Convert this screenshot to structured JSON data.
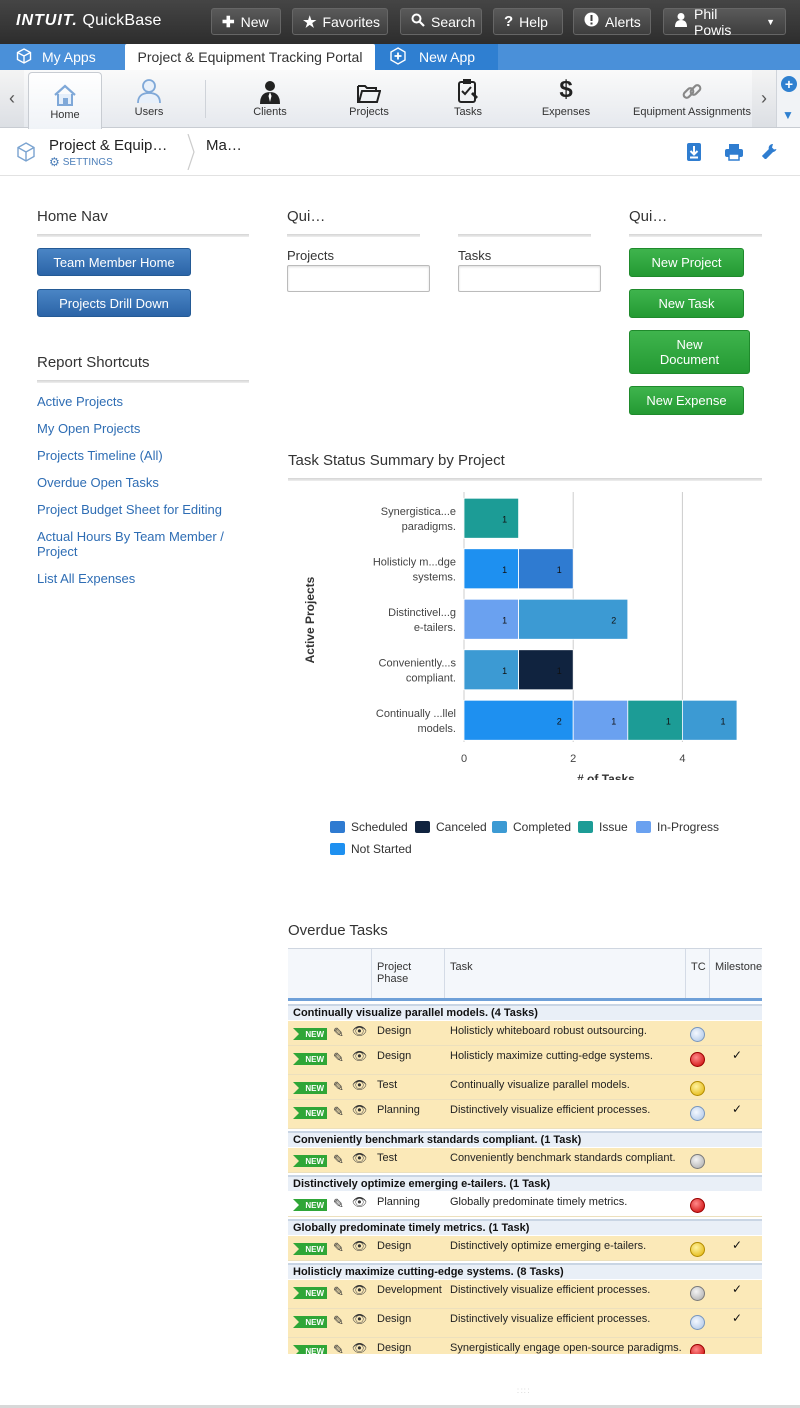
{
  "topbar": {
    "logo_brand": "INTUIT.",
    "logo_product": "QuickBase",
    "buttons": [
      {
        "label": "New",
        "icon": "plus-icon"
      },
      {
        "label": "Favorites",
        "icon": "star-icon"
      },
      {
        "label": "Search",
        "icon": "search-icon"
      },
      {
        "label": "Help",
        "icon": "help-icon"
      },
      {
        "label": "Alerts",
        "icon": "alert-icon"
      }
    ],
    "user": "Phil Powis"
  },
  "tabs": {
    "my_apps": "My Apps",
    "portal": "Project & Equipment Tracking Portal",
    "new_app": "New App"
  },
  "nav": {
    "items": [
      {
        "label": "Home",
        "icon": "home-icon"
      },
      {
        "label": "Users",
        "icon": "users-icon"
      },
      {
        "label": "Clients",
        "icon": "person-icon"
      },
      {
        "label": "Projects",
        "icon": "folder-icon"
      },
      {
        "label": "Tasks",
        "icon": "clipboard-icon"
      },
      {
        "label": "Expenses",
        "icon": "dollar-icon"
      },
      {
        "label": "Equipment Assignments",
        "icon": "link-icon"
      }
    ]
  },
  "breadcrumb": {
    "app_name": "Project & Equip…",
    "settings": "SETTINGS",
    "page": "Ma…"
  },
  "home_nav": {
    "title": "Home Nav",
    "buttons": [
      "Team Member Home",
      "Projects Drill Down"
    ]
  },
  "report_shortcuts": {
    "title": "Report Shortcuts",
    "links": [
      "Active Projects",
      "My Open Projects",
      "Projects Timeline (All)",
      "Overdue Open Tasks",
      "Project Budget Sheet for Editing",
      "Actual Hours By Team Member / Project",
      "List All Expenses"
    ]
  },
  "quick_search": {
    "title": "Qui…",
    "fields": [
      {
        "label": "Projects",
        "value": ""
      },
      {
        "label": "Tasks",
        "value": ""
      }
    ]
  },
  "quick_add": {
    "title": "Qui…",
    "buttons": [
      "New Project",
      "New Task",
      "New Document",
      "New Expense"
    ]
  },
  "chart_title": "Task Status Summary by Project",
  "chart_data": {
    "type": "bar",
    "orientation": "horizontal",
    "stacked": true,
    "categories": [
      "Synergistica...e paradigms.",
      "Holisticly m...dge systems.",
      "Distinctivel...g e-tailers.",
      "Conveniently...s compliant.",
      "Continually ...llel models."
    ],
    "series": [
      {
        "name": "Not Started",
        "color": "#1e90f0",
        "values": [
          0,
          1,
          0,
          0,
          2
        ]
      },
      {
        "name": "Scheduled",
        "color": "#2f7bd1",
        "values": [
          0,
          1,
          0,
          0,
          0
        ]
      },
      {
        "name": "In-Progress",
        "color": "#6aa1f0",
        "values": [
          0,
          0,
          1,
          0,
          1
        ]
      },
      {
        "name": "Issue",
        "color": "#1c9c96",
        "values": [
          1,
          0,
          0,
          0,
          1
        ]
      },
      {
        "name": "Completed",
        "color": "#3c9ad3",
        "values": [
          0,
          0,
          2,
          1,
          1
        ]
      },
      {
        "name": "Canceled",
        "color": "#10233f",
        "values": [
          0,
          0,
          0,
          1,
          0
        ]
      }
    ],
    "xlabel": "# of Tasks",
    "ylabel": "Active Projects",
    "xlim": [
      0,
      5
    ],
    "xticks": [
      0,
      2,
      4
    ],
    "legend": {
      "position": "bottom",
      "order": [
        "Scheduled",
        "Canceled",
        "Completed",
        "Issue",
        "In-Progress",
        "Not Started"
      ]
    },
    "grid": true
  },
  "overdue": {
    "title": "Overdue Tasks",
    "columns": [
      "Project Phase",
      "Task",
      "TC",
      "Milestone"
    ],
    "new_tag": "NEW",
    "groups": [
      {
        "label": "Continually visualize parallel models.  (4 Tasks)",
        "rows": [
          {
            "phase": "Design",
            "task": "Holisticly whiteboard robust outsourcing.",
            "tc": "clock",
            "milestone": ""
          },
          {
            "phase": "Design",
            "task": "Holisticly maximize cutting-edge systems.",
            "tc": "red",
            "milestone": "✓"
          },
          {
            "phase": "Test",
            "task": "Continually visualize parallel models.",
            "tc": "yellow",
            "milestone": ""
          },
          {
            "phase": "Planning",
            "task": "Distinctively visualize efficient processes.",
            "tc": "clock",
            "milestone": "✓"
          }
        ]
      },
      {
        "label": "Conveniently benchmark standards compliant.  (1 Task)",
        "rows": [
          {
            "phase": "Test",
            "task": "Conveniently benchmark standards compliant.",
            "tc": "gray",
            "milestone": ""
          }
        ]
      },
      {
        "label": "Distinctively optimize emerging e-tailers.  (1 Task)",
        "rows": [
          {
            "phase": "Planning",
            "task": "Globally predominate timely metrics.",
            "tc": "red",
            "milestone": ""
          }
        ]
      },
      {
        "label": "Globally predominate timely metrics.  (1 Task)",
        "rows": [
          {
            "phase": "Design",
            "task": "Distinctively optimize emerging e-tailers.",
            "tc": "yellow",
            "milestone": "✓"
          }
        ]
      },
      {
        "label": "Holisticly maximize cutting-edge systems.  (8 Tasks)",
        "rows": [
          {
            "phase": "Development",
            "task": "Distinctively visualize efficient processes.",
            "tc": "gray",
            "milestone": "✓"
          },
          {
            "phase": "Design",
            "task": "Distinctively visualize efficient processes.",
            "tc": "clock",
            "milestone": "✓"
          },
          {
            "phase": "Design",
            "task": "Synergistically engage open-source paradigms.",
            "tc": "red",
            "milestone": ""
          }
        ]
      }
    ]
  }
}
